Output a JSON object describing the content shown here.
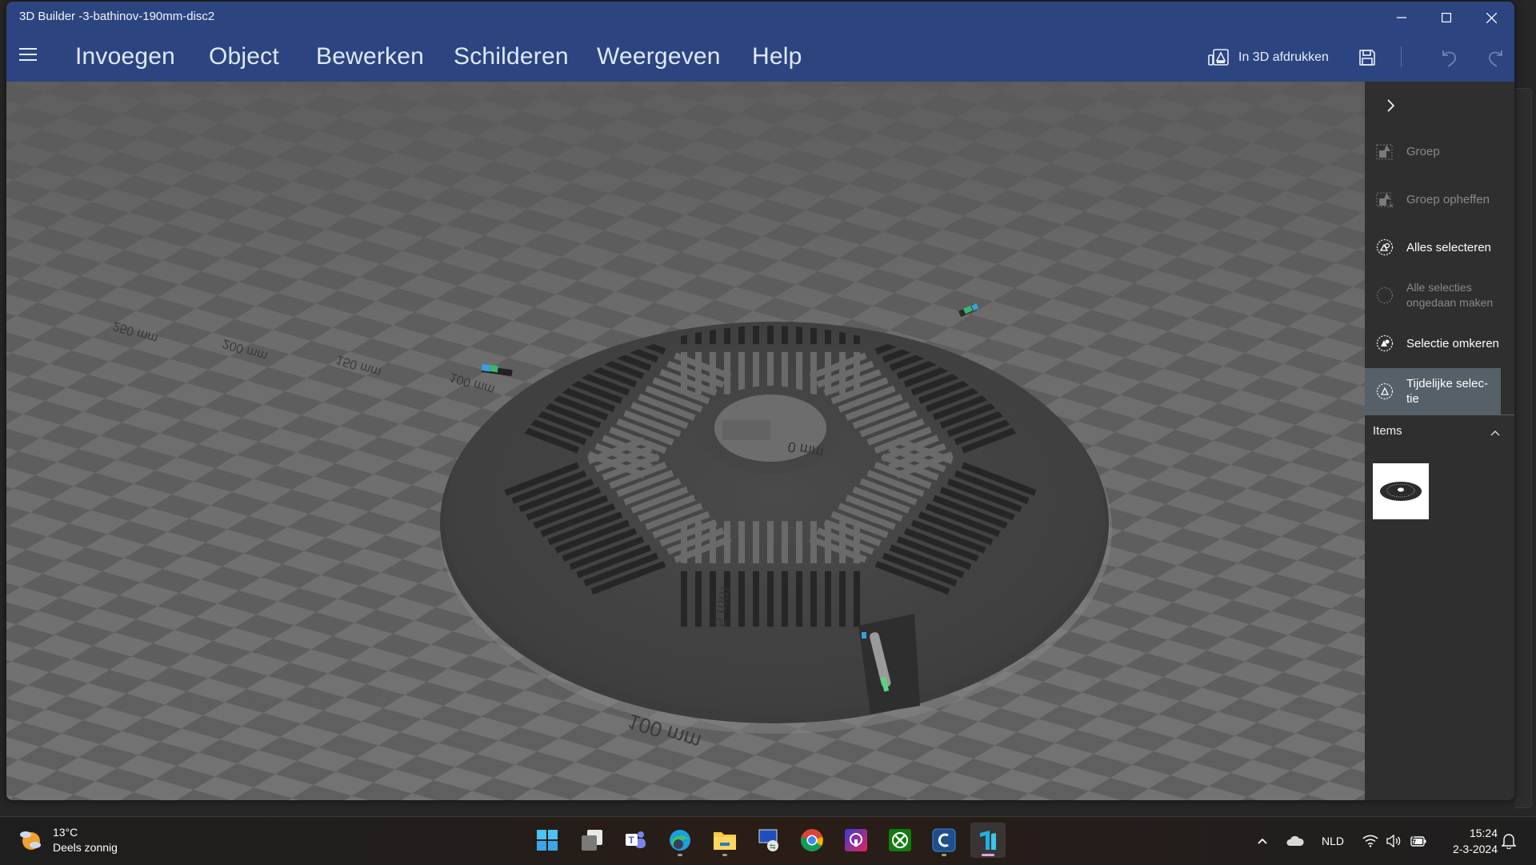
{
  "window": {
    "title": "3D Builder -3-bathinov-190mm-disc2",
    "controls": {
      "minimize": "minimize",
      "maximize": "maximize",
      "close": "close"
    }
  },
  "menubar": {
    "items": [
      "Invoegen",
      "Object",
      "Bewerken",
      "Schilderen",
      "Weergeven",
      "Help"
    ],
    "print_label": "In 3D afdrukken",
    "accent": "#2c4580"
  },
  "viewport": {
    "ruler_labels": [
      "250 mm",
      "200 mm",
      "150 mm",
      "100 mm",
      "100 mm",
      "0 mm",
      "5 mm"
    ],
    "object_name": "bathinov-190mm-disc2"
  },
  "panel": {
    "items": [
      {
        "label": "Groep",
        "icon": "group-icon",
        "enabled": false
      },
      {
        "label": "Groep opheffen",
        "icon": "ungroup-icon",
        "enabled": false
      },
      {
        "label": "Alles selecteren",
        "icon": "select-all-icon",
        "enabled": true
      },
      {
        "label": "Alle selecties ongedaan maken",
        "icon": "deselect-all-icon",
        "enabled": false
      },
      {
        "label": "Selectie omkeren",
        "icon": "invert-selection-icon",
        "enabled": true
      },
      {
        "label": "Tijdelijke selec-tie",
        "icon": "temporary-selection-icon",
        "enabled": true,
        "active": true
      }
    ],
    "items_header": "Items"
  },
  "taskbar": {
    "weather": {
      "temp": "13°C",
      "condition": "Deels zonnig"
    },
    "apps": [
      "Start",
      "Task View",
      "Microsoft Teams",
      "Microsoft Edge",
      "File Explorer",
      "Remote Desktop",
      "Google Chrome",
      "Podcast App",
      "Xbox",
      "CCleaner",
      "3D Builder"
    ],
    "language": "NLD",
    "time": "15:24",
    "date": "2-3-2024"
  }
}
